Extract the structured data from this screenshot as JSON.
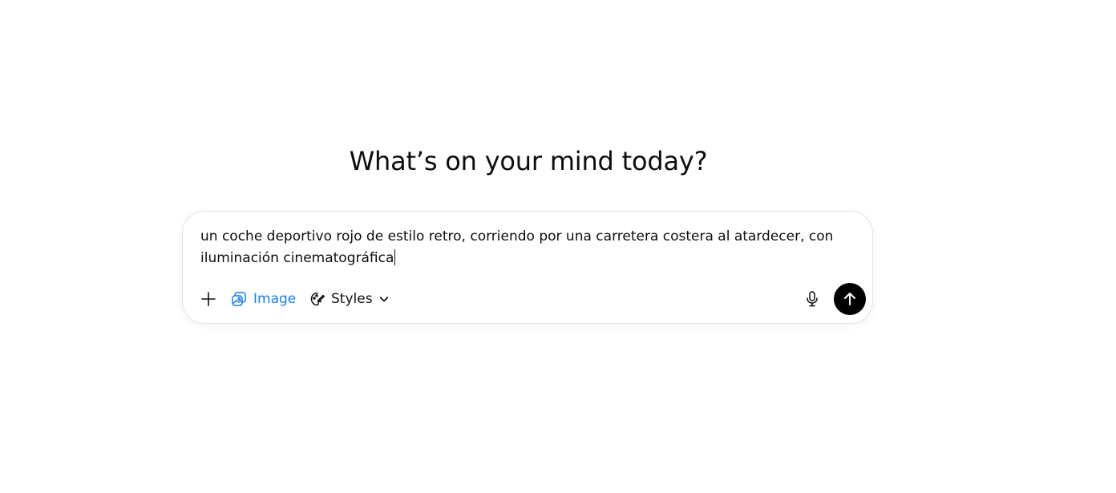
{
  "headline": "What’s on your mind today?",
  "composer": {
    "text_line1": "un coche deportivo rojo de estilo retro, corriendo por una carretera costera al atardecer, con",
    "text_line2": "iluminación cinematográfica"
  },
  "toolbar": {
    "plus_icon": "plus-icon",
    "image_label": "Image",
    "image_icon": "image-icon",
    "styles_label": "Styles",
    "styles_icon": "palette-icon",
    "mic_icon": "microphone-icon",
    "send_icon": "arrow-up-icon"
  },
  "colors": {
    "image_accent": "#1a7fe0",
    "send_bg": "#000000",
    "border": "#e3e3e3"
  }
}
